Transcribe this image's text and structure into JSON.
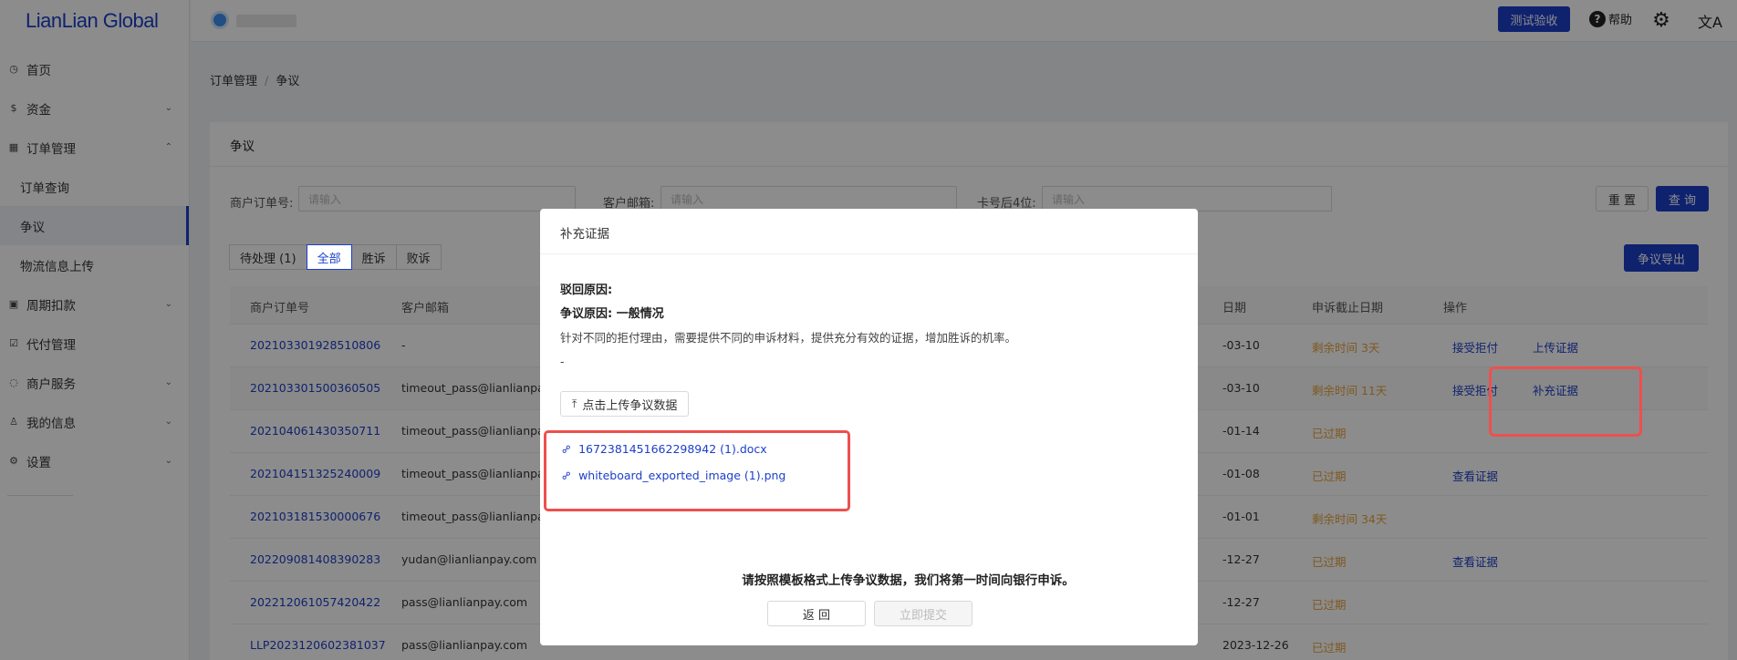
{
  "brand": {
    "logo_text": "LianLian Global"
  },
  "topbar": {
    "user_name": "•••••••",
    "test_button": "测试验收",
    "help_label": "帮助",
    "help_icon": "?",
    "gear_icon": "⚙",
    "lang_icon": "文A"
  },
  "sidebar": {
    "items": [
      {
        "label": "首页",
        "icon": "◷",
        "chevron": ""
      },
      {
        "label": "资金",
        "icon": "$",
        "chevron": "⌄"
      },
      {
        "label": "订单管理",
        "icon": "▦",
        "chevron": "⌃"
      },
      {
        "label": "订单查询",
        "icon": "",
        "chevron": ""
      },
      {
        "label": "争议",
        "icon": "",
        "chevron": ""
      },
      {
        "label": "物流信息上传",
        "icon": "",
        "chevron": ""
      },
      {
        "label": "周期扣款",
        "icon": "▣",
        "chevron": "⌄"
      },
      {
        "label": "代付管理",
        "icon": "☑",
        "chevron": ""
      },
      {
        "label": "商户服务",
        "icon": "◌",
        "chevron": "⌄"
      },
      {
        "label": "我的信息",
        "icon": "♙",
        "chevron": "⌄"
      },
      {
        "label": "设置",
        "icon": "⚙",
        "chevron": "⌄"
      }
    ]
  },
  "breadcrumb": {
    "parent": "订单管理",
    "separator": "/",
    "current": "争议"
  },
  "card": {
    "title": "争议"
  },
  "filters": {
    "order_no_label": "商户订单号:",
    "email_label": "客户邮箱:",
    "card_label": "卡号后4位:",
    "placeholder": "请输入",
    "reset": "重 置",
    "query": "查 询"
  },
  "tabs": [
    "待处理 (1)",
    "全部",
    "胜诉",
    "败诉"
  ],
  "export_button": "争议导出",
  "table": {
    "headers": {
      "order_no": "商户订单号",
      "email": "客户邮箱",
      "date_partial": "日期",
      "deadline": "申诉截止日期",
      "actions": "操作"
    },
    "rows": [
      {
        "order_no": "202103301928510806",
        "email": "-",
        "date": "-03-10",
        "deadline": "剩余时间 3天",
        "action1": "接受拒付",
        "action2": "上传证据"
      },
      {
        "order_no": "202103301500360505",
        "email": "timeout_pass@lianlianpay.com",
        "date": "-03-10",
        "deadline": "剩余时间 11天",
        "action1": "接受拒付",
        "action2": "补充证据"
      },
      {
        "order_no": "202104061430350711",
        "email": "timeout_pass@lianlianpay.com",
        "date": "-01-14",
        "deadline": "已过期",
        "action1": "",
        "action2": ""
      },
      {
        "order_no": "202104151325240009",
        "email": "timeout_pass@lianlianpay.com",
        "date": "-01-08",
        "deadline": "已过期",
        "action1": "查看证据",
        "action2": ""
      },
      {
        "order_no": "202103181530000676",
        "email": "timeout_pass@lianlianpay.com",
        "date": "-01-01",
        "deadline": "剩余时间 34天",
        "action1": "",
        "action2": ""
      },
      {
        "order_no": "202209081408390283",
        "email": "yudan@lianlianpay.com",
        "date": "-12-27",
        "deadline": "已过期",
        "action1": "查看证据",
        "action2": ""
      },
      {
        "order_no": "202212061057420422",
        "email": "pass@lianlianpay.com",
        "date": "-12-27",
        "deadline": "已过期",
        "action1": "",
        "action2": ""
      },
      {
        "order_no": "LLP2023120602381037",
        "email": "pass@lianlianpay.com",
        "date": "2023-12-26",
        "deadline": "已过期",
        "action1": "",
        "action2": ""
      }
    ]
  },
  "dialog": {
    "title": "补充证据",
    "reject_reason_label": "驳回原因:",
    "dispute_reason_label": "争议原因: 一般情况",
    "tip": "针对不同的拒付理由，需要提供不同的申诉材料，提供充分有效的证据，增加胜诉的机率。",
    "dash": "-",
    "upload_button": "点击上传争议数据",
    "upload_icon": "⤒",
    "files": [
      "1672381451662298942 (1).docx",
      "whiteboard_exported_image (1).png"
    ],
    "file_icon": "⚯",
    "note": "请按照模板格式上传争议数据，我们将第一时间向银行申诉。",
    "back": "返 回",
    "submit": "立即提交"
  },
  "colors": {
    "primary": "#1c3fc9",
    "warning": "#e6a23c",
    "highlight": "#ef4f4f"
  }
}
